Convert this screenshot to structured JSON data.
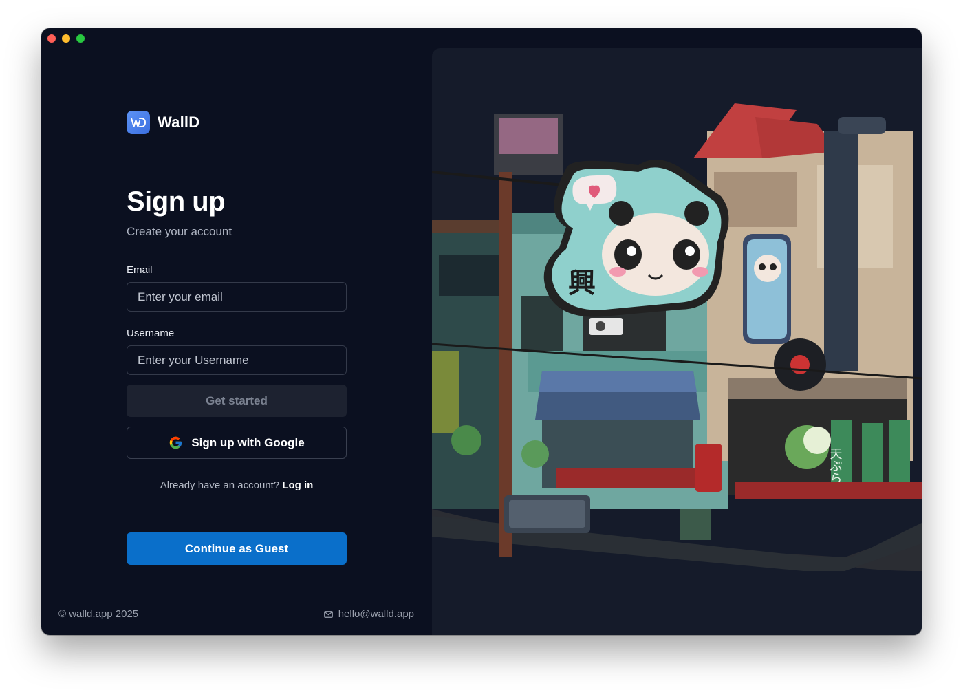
{
  "window": {
    "controls": [
      "close",
      "minimize",
      "maximize"
    ]
  },
  "brand": {
    "name": "WallD",
    "icon": "walld-logo-icon"
  },
  "signup": {
    "title": "Sign up",
    "subtitle": "Create your account",
    "email_label": "Email",
    "email_placeholder": "Enter your email",
    "email_value": "",
    "username_label": "Username",
    "username_placeholder": "Enter your Username",
    "username_value": "",
    "get_started_label": "Get started",
    "google_label": "Sign up with Google",
    "google_icon": "google-icon",
    "already_text": "Already have an account?",
    "login_label": "Log in",
    "guest_label": "Continue as Guest"
  },
  "footer": {
    "copyright": "© walld.app 2025",
    "email": "hello@walld.app",
    "mail_icon": "mail-icon"
  },
  "preview": {
    "sign_char": "興",
    "banner_text": "天ぷら"
  },
  "colors": {
    "background": "#0b1020",
    "panel": "#151b2a",
    "guest_button": "#0a6fca",
    "logo": "#4a82ee"
  }
}
